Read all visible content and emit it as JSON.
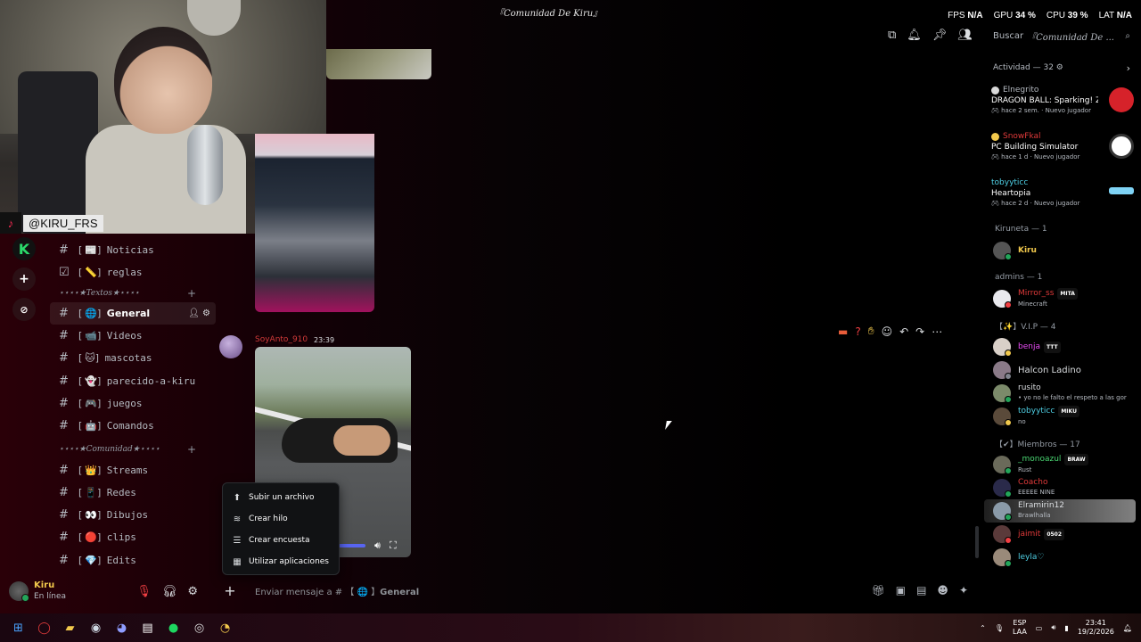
{
  "window": {
    "title": "『Comunidad De Kiru』"
  },
  "stats": {
    "fps_label": "FPS",
    "fps_val": "N/A",
    "gpu_label": "GPU",
    "gpu_val": "34 %",
    "cpu_label": "CPU",
    "cpu_val": "39 %",
    "lat_label": "LAT",
    "lat_val": "N/A"
  },
  "search": {
    "label": "Buscar",
    "query": "『Comunidad De ..."
  },
  "overlay": {
    "handle": "@KIRU_FRS"
  },
  "channels": {
    "top": [
      {
        "emoji": "📰",
        "name": "Noticias"
      },
      {
        "emoji": "📏",
        "name": "reglas"
      }
    ],
    "cat_textos": "⋆⋆⋆⋆★Textos★⋆⋆⋆⋆",
    "textos": [
      {
        "emoji": "🌐",
        "name": "General"
      },
      {
        "emoji": "📹",
        "name": "Videos"
      },
      {
        "emoji": "🐱",
        "name": "mascotas"
      },
      {
        "emoji": "👻",
        "name": "parecido-a-kiru"
      },
      {
        "emoji": "🎮",
        "name": "juegos"
      },
      {
        "emoji": "🤖",
        "name": "Comandos"
      }
    ],
    "cat_comunidad": "⋆⋆⋆⋆★Comunidad★⋆⋆⋆⋆",
    "comunidad": [
      {
        "emoji": "👑",
        "name": "Streams"
      },
      {
        "emoji": "📱",
        "name": "Redes"
      },
      {
        "emoji": "👀",
        "name": "Dibujos"
      },
      {
        "emoji": "🔴",
        "name": "clips"
      },
      {
        "emoji": "💎",
        "name": "Edits"
      }
    ]
  },
  "user": {
    "name": "Kiru",
    "status": "En línea"
  },
  "message": {
    "author": "SoyAnto_910",
    "time": "23:39"
  },
  "popup": [
    {
      "icon": "upload-icon",
      "label": "Subir un archivo"
    },
    {
      "icon": "thread-icon",
      "label": "Crear hilo"
    },
    {
      "icon": "poll-icon",
      "label": "Crear encuesta"
    },
    {
      "icon": "apps-icon",
      "label": "Utilizar aplicaciones"
    }
  ],
  "composer": {
    "placeholder_prefix": "Enviar mensaje a # 【",
    "placeholder_channel": "General"
  },
  "activity": {
    "header": "Actividad — 32",
    "items": [
      {
        "user": "Elnegrito",
        "user_color": "#b5bac1",
        "game": "DRAGON BALL: Sparking! Z...",
        "ago": "hace 2 sem.",
        "badge": "Nuevo jugador",
        "icon_color": "#d6222a"
      },
      {
        "user": "SnowFkal",
        "user_color": "#e03a3a",
        "game": "PC Building Simulator",
        "ago": "hace 1 d",
        "badge": "Nuevo jugador",
        "icon_color": "#ffffff"
      },
      {
        "user": "tobyyticc",
        "user_color": "#4fd1e6",
        "game": "Heartopia",
        "ago": "hace 2 d",
        "badge": "Nuevo jugador",
        "icon_color": "#7fd3f5"
      }
    ]
  },
  "members": {
    "kiruneta_header": "Kiruneta — 1",
    "kiruneta": [
      {
        "name": "Kiru",
        "color": "#f2c94c",
        "tag": "",
        "sub": ""
      }
    ],
    "admins_header": "admins — 1",
    "admins": [
      {
        "name": "Mirror_ss",
        "color": "#e03a3a",
        "tag": "MITA",
        "sub": "Minecraft"
      }
    ],
    "vip_header": "【✨】V.I.P — 4",
    "vip": [
      {
        "name": "benja",
        "color": "#e84cf5",
        "tag": "TTT",
        "sub": ""
      },
      {
        "name": "Halcon Ladino",
        "color": "#dbdee1",
        "tag": "",
        "sub": ""
      },
      {
        "name": "rusito",
        "color": "#dbdee1",
        "tag": "",
        "sub": "• yo no le falto el respeto a las gor"
      },
      {
        "name": "tobyyticc",
        "color": "#4fd1e6",
        "tag": "MIKU",
        "sub": "no"
      }
    ],
    "miembros_header": "【✔】Miembros — 17",
    "miembros": [
      {
        "name": "_monoazul",
        "color": "#4ad672",
        "tag": "BRAW",
        "sub": "Rust"
      },
      {
        "name": "Coacho",
        "color": "#e03a3a",
        "tag": "",
        "sub": "EEEEE NINE"
      },
      {
        "name": "Elramirin12",
        "color": "#dbdee1",
        "tag": "",
        "sub": "Brawlhalla"
      },
      {
        "name": "jaimit",
        "color": "#e03a3a",
        "tag": "0502",
        "sub": ""
      },
      {
        "name": "leyla♡",
        "color": "#4fd1e6",
        "tag": "",
        "sub": ""
      }
    ]
  },
  "taskbar": {
    "lang1": "ESP",
    "lang2": "LAA",
    "time": "23:41",
    "date": "19/2/2026"
  }
}
